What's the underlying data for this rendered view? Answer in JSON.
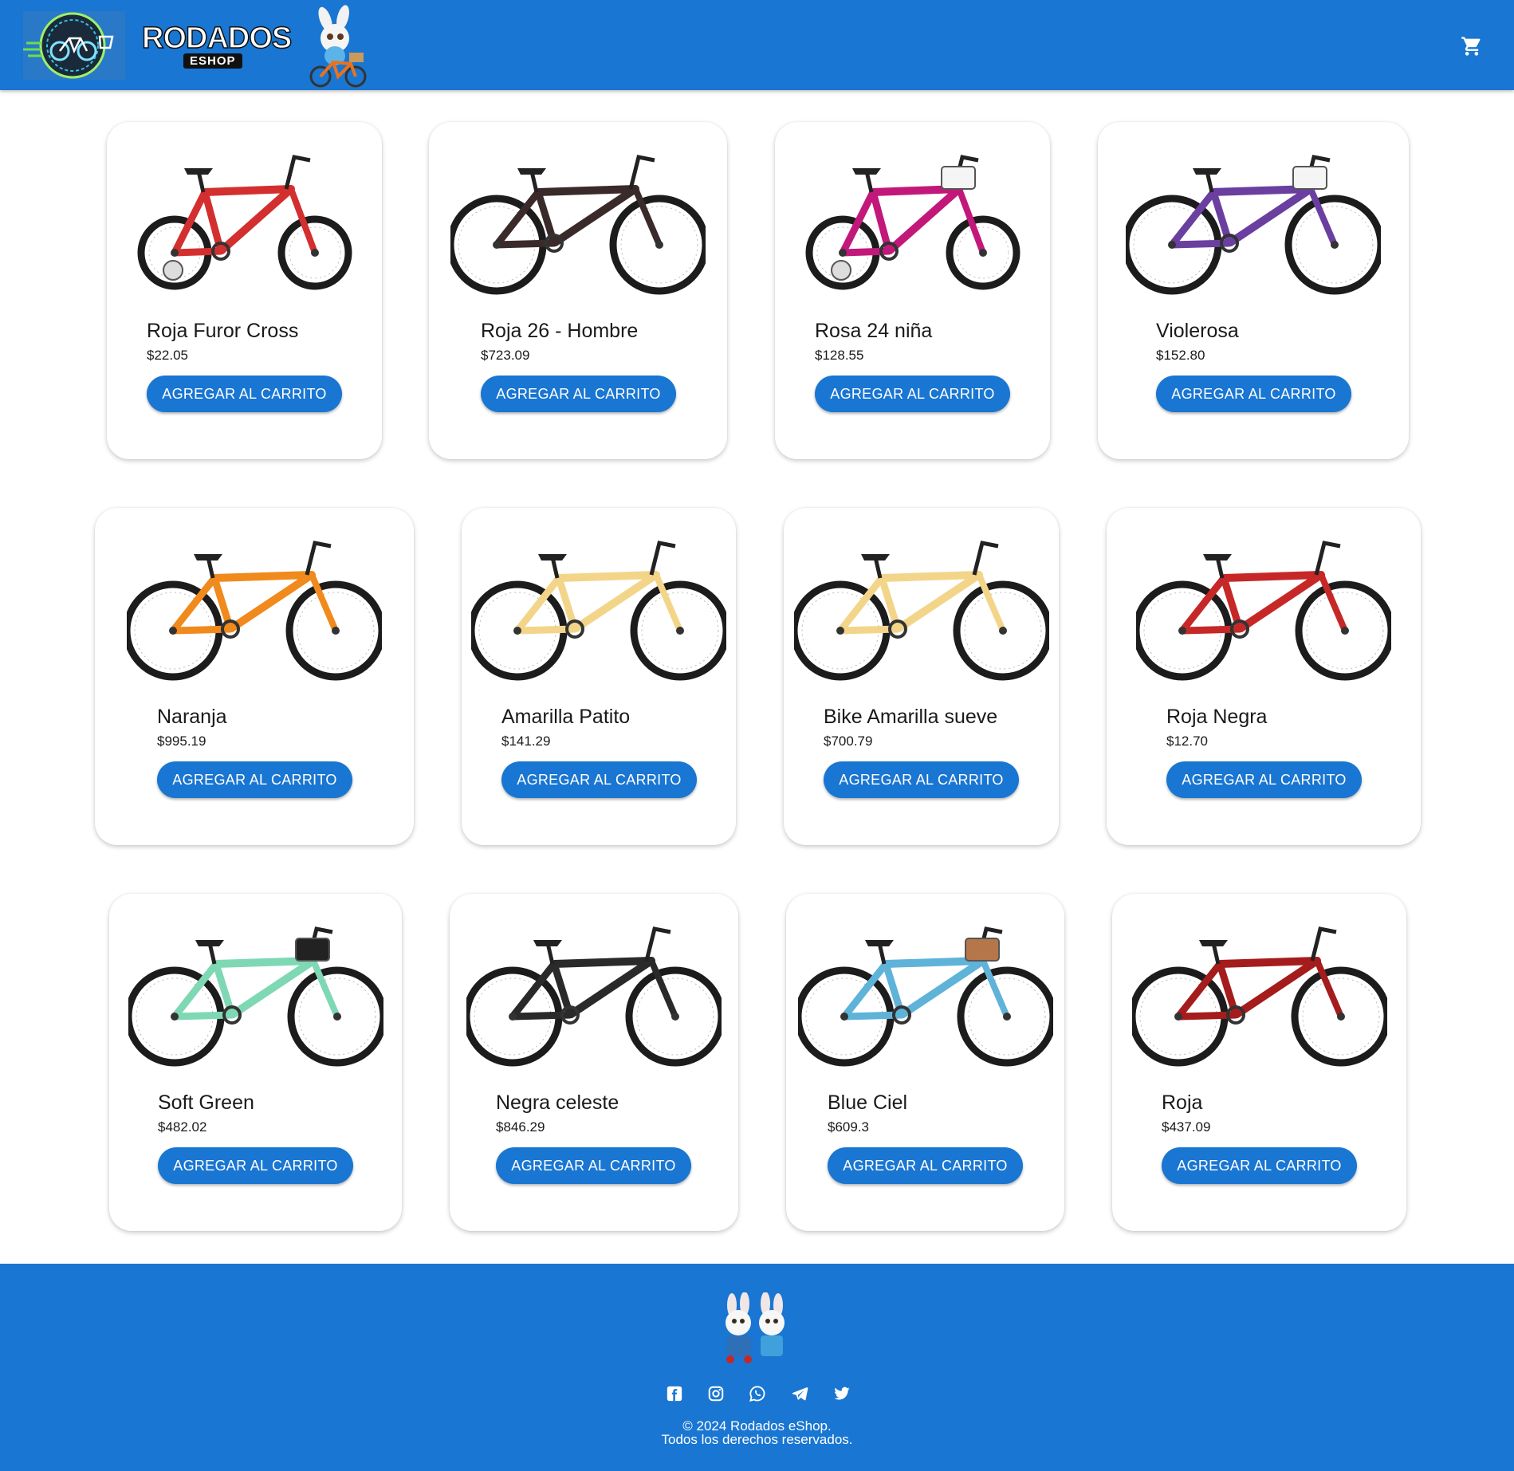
{
  "header": {
    "brand_main": "RODADOS",
    "brand_sub": "ESHOP",
    "logo_icon": "bike-cart-logo-icon",
    "mascot_icon": "bunny-on-bike-icon",
    "cart_icon": "shopping-cart-icon"
  },
  "products": [
    {
      "name": "Roja Furor Cross",
      "price": "$22.05",
      "button": "AGREGAR AL CARRITO",
      "color": "#d32f2f"
    },
    {
      "name": "Roja 26 - Hombre",
      "price": "$723.09",
      "button": "AGREGAR AL CARRITO",
      "color": "#3a2a2a"
    },
    {
      "name": "Rosa 24 niña",
      "price": "$128.55",
      "button": "AGREGAR AL CARRITO",
      "color": "#c2187a"
    },
    {
      "name": "Violerosa",
      "price": "$152.80",
      "button": "AGREGAR AL CARRITO",
      "color": "#6a3fa0"
    },
    {
      "name": "Naranja",
      "price": "$995.19",
      "button": "AGREGAR AL CARRITO",
      "color": "#f08a1c"
    },
    {
      "name": "Amarilla Patito",
      "price": "$141.29",
      "button": "AGREGAR AL CARRITO",
      "color": "#f3d58a"
    },
    {
      "name": "Bike Amarilla sueve",
      "price": "$700.79",
      "button": "AGREGAR AL CARRITO",
      "color": "#f3d58a"
    },
    {
      "name": "Roja Negra",
      "price": "$12.70",
      "button": "AGREGAR AL CARRITO",
      "color": "#c62828"
    },
    {
      "name": "Soft Green",
      "price": "$482.02",
      "button": "AGREGAR AL CARRITO",
      "color": "#7fd8b4"
    },
    {
      "name": "Negra celeste",
      "price": "$846.29",
      "button": "AGREGAR AL CARRITO",
      "color": "#2a2a2a"
    },
    {
      "name": "Blue Ciel",
      "price": "$609.3",
      "button": "AGREGAR AL CARRITO",
      "color": "#5fb3d9"
    },
    {
      "name": "Roja",
      "price": "$437.09",
      "button": "AGREGAR AL CARRITO",
      "color": "#a51c1c"
    }
  ],
  "footer": {
    "mascots_icon": "bunny-mascots-icon",
    "social": [
      "facebook-icon",
      "instagram-icon",
      "whatsapp-icon",
      "telegram-icon",
      "twitter-icon"
    ],
    "copyright_line1": "© 2024 Rodados eShop.",
    "copyright_line2": "Todos los derechos reservados."
  },
  "colors": {
    "primary": "#1976d2",
    "background": "#ffffff"
  }
}
